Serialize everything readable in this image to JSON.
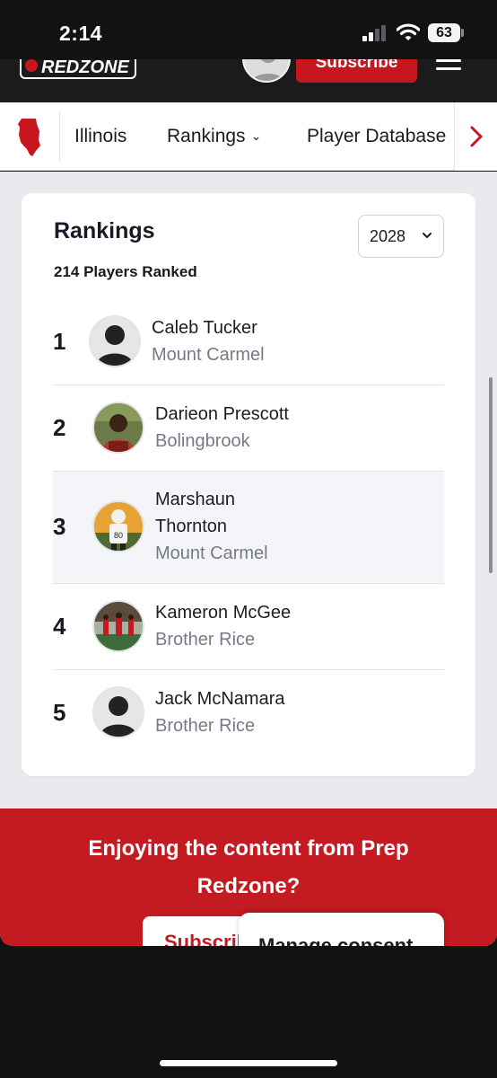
{
  "status_bar": {
    "time": "2:14",
    "battery": "63"
  },
  "header": {
    "logo_text": "REDZONE",
    "subscribe_label": "Subscribe"
  },
  "nav": {
    "items": [
      {
        "label": "Illinois"
      },
      {
        "label": "Rankings"
      },
      {
        "label": "Player Database"
      }
    ]
  },
  "rankings": {
    "title": "Rankings",
    "subtitle": "214 Players Ranked",
    "year": "2028",
    "players": [
      {
        "rank": "1",
        "name": "Caleb Tucker",
        "school": "Mount Carmel",
        "avatar": "placeholder"
      },
      {
        "rank": "2",
        "name": "Darieon Prescott",
        "school": "Bolingbrook",
        "avatar": "photo"
      },
      {
        "rank": "3",
        "name": "Marshaun Thornton",
        "school": "Mount Carmel",
        "avatar": "photo"
      },
      {
        "rank": "4",
        "name": "Kameron McGee",
        "school": "Brother Rice",
        "avatar": "photo"
      },
      {
        "rank": "5",
        "name": "Jack McNamara",
        "school": "Brother Rice",
        "avatar": "placeholder"
      }
    ]
  },
  "promo": {
    "text": "Enjoying the content from Prep Redzone?",
    "subscribe_label": "Subscribe",
    "manage_consent_label": "Manage consent"
  },
  "colors": {
    "brand_red": "#c8161e",
    "page_bg": "#e9eaee",
    "dark_bar": "#1b1b1d"
  }
}
